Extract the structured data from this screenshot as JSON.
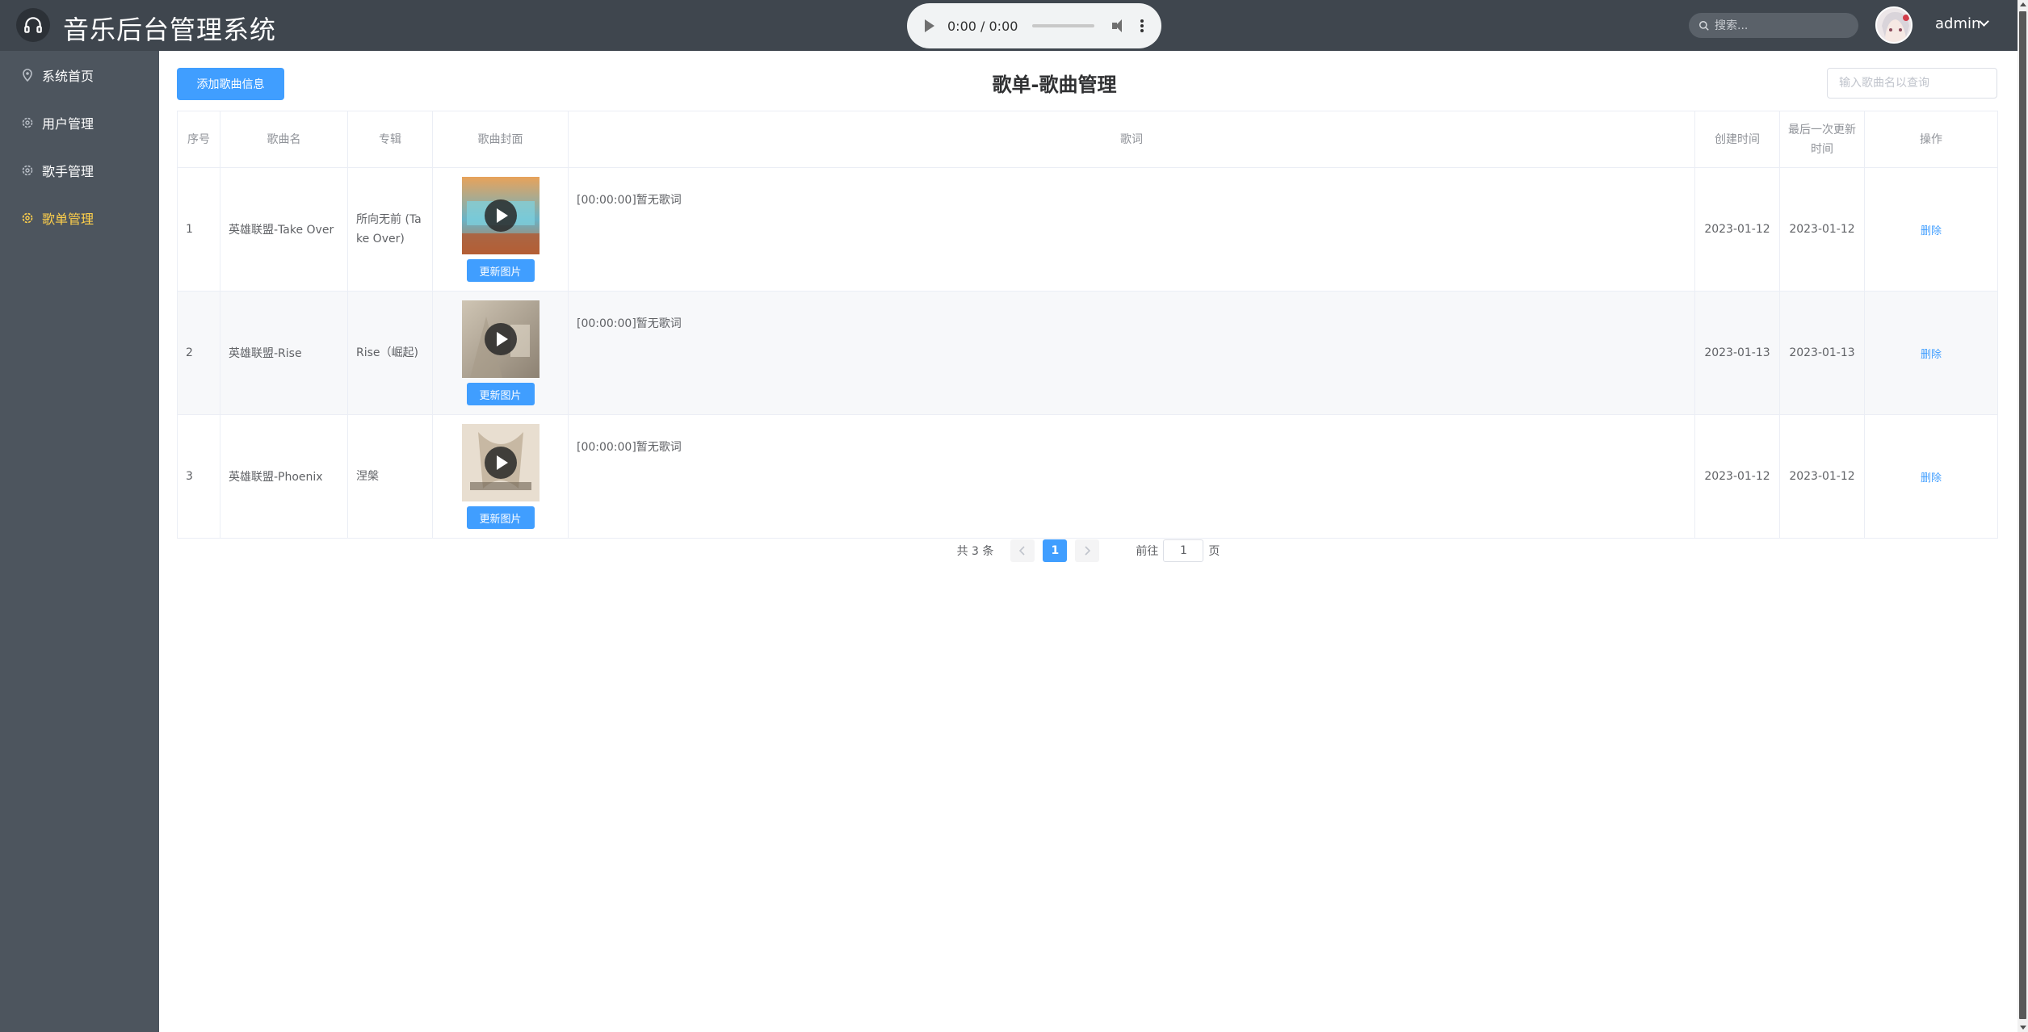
{
  "header": {
    "title": "音乐后台管理系统",
    "audio_time": "0:00 / 0:00",
    "search_placeholder": "搜索...",
    "user_name": "admin"
  },
  "sidebar": {
    "items": [
      {
        "label": "系统首页",
        "icon": "location-pin-icon"
      },
      {
        "label": "用户管理",
        "icon": "gear-icon"
      },
      {
        "label": "歌手管理",
        "icon": "gear-icon"
      },
      {
        "label": "歌单管理",
        "icon": "gear-icon",
        "active": true
      }
    ]
  },
  "main": {
    "add_button": "添加歌曲信息",
    "page_title": "歌单-歌曲管理",
    "query_placeholder": "输入歌曲名以查询"
  },
  "table": {
    "headers": [
      "序号",
      "歌曲名",
      "专辑",
      "歌曲封面",
      "歌词",
      "创建时间",
      "最后一次更新时间",
      "操作"
    ],
    "update_image_label": "更新图片",
    "delete_label": "删除",
    "rows": [
      {
        "index": "1",
        "song": "英雄联盟-Take Over",
        "album": "所向无前 (Take Over)",
        "lyric": "[00:00:00]暂无歌词",
        "created": "2023-01-12",
        "updated": "2023-01-12"
      },
      {
        "index": "2",
        "song": "英雄联盟-Rise",
        "album": "Rise（崛起)",
        "lyric": "[00:00:00]暂无歌词",
        "created": "2023-01-13",
        "updated": "2023-01-13"
      },
      {
        "index": "3",
        "song": "英雄联盟-Phoenix",
        "album": "涅槃",
        "lyric": "[00:00:00]暂无歌词",
        "created": "2023-01-12",
        "updated": "2023-01-12"
      }
    ]
  },
  "pagination": {
    "total": "共 3 条",
    "current": "1",
    "goto_prefix": "前往",
    "goto_value": "1",
    "goto_suffix": "页"
  },
  "colors": {
    "header_bg": "#3f464e",
    "sidebar_bg": "#4d555e",
    "active_menu": "#ffd04b",
    "primary": "#409eff"
  }
}
